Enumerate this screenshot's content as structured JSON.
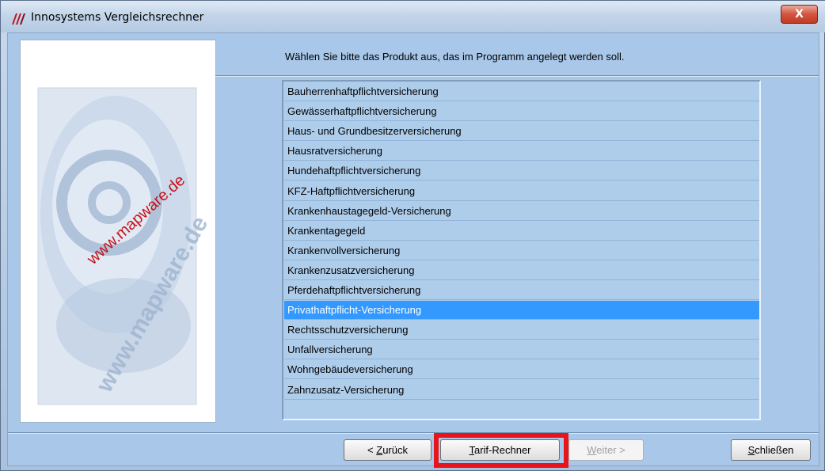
{
  "window": {
    "title": "Innosystems Vergleichsrechner",
    "close_label": "X"
  },
  "sidebar_image": {
    "watermark_text": "www.mapware.de"
  },
  "main": {
    "prompt": "Wählen Sie bitte das Produkt aus, das im Programm angelegt werden soll.",
    "products": [
      "Bauherrenhaftpflichtversicherung",
      "Gewässerhaftpflichtversicherung",
      "Haus- und Grundbesitzerversicherung",
      "Hausratversicherung",
      "Hundehaftpflichtversicherung",
      "KFZ-Haftpflichtversicherung",
      "Krankenhaustagegeld-Versicherung",
      "Krankentagegeld",
      "Krankenvollversicherung",
      "Krankenzusatzversicherung",
      "Pferdehaftpflichtversicherung",
      "Privathaftpflicht-Versicherung",
      "Rechtsschutzversicherung",
      "Unfallversicherung",
      "Wohngebäudeversicherung",
      "Zahnzusatz-Versicherung"
    ],
    "selected_product": "Privathaftpflicht-Versicherung"
  },
  "buttons": {
    "back_prefix": "< ",
    "back_mnemonic": "Z",
    "back_rest": "urück",
    "tarif_mnemonic": "T",
    "tarif_rest": "arif-Rechner",
    "next_mnemonic": "W",
    "next_rest": "eiter >",
    "close_mnemonic": "S",
    "close_rest": "chließen"
  },
  "colors": {
    "selection": "#3399ff",
    "highlight_outline": "#e8141b",
    "client_background": "#a8c7e9"
  }
}
